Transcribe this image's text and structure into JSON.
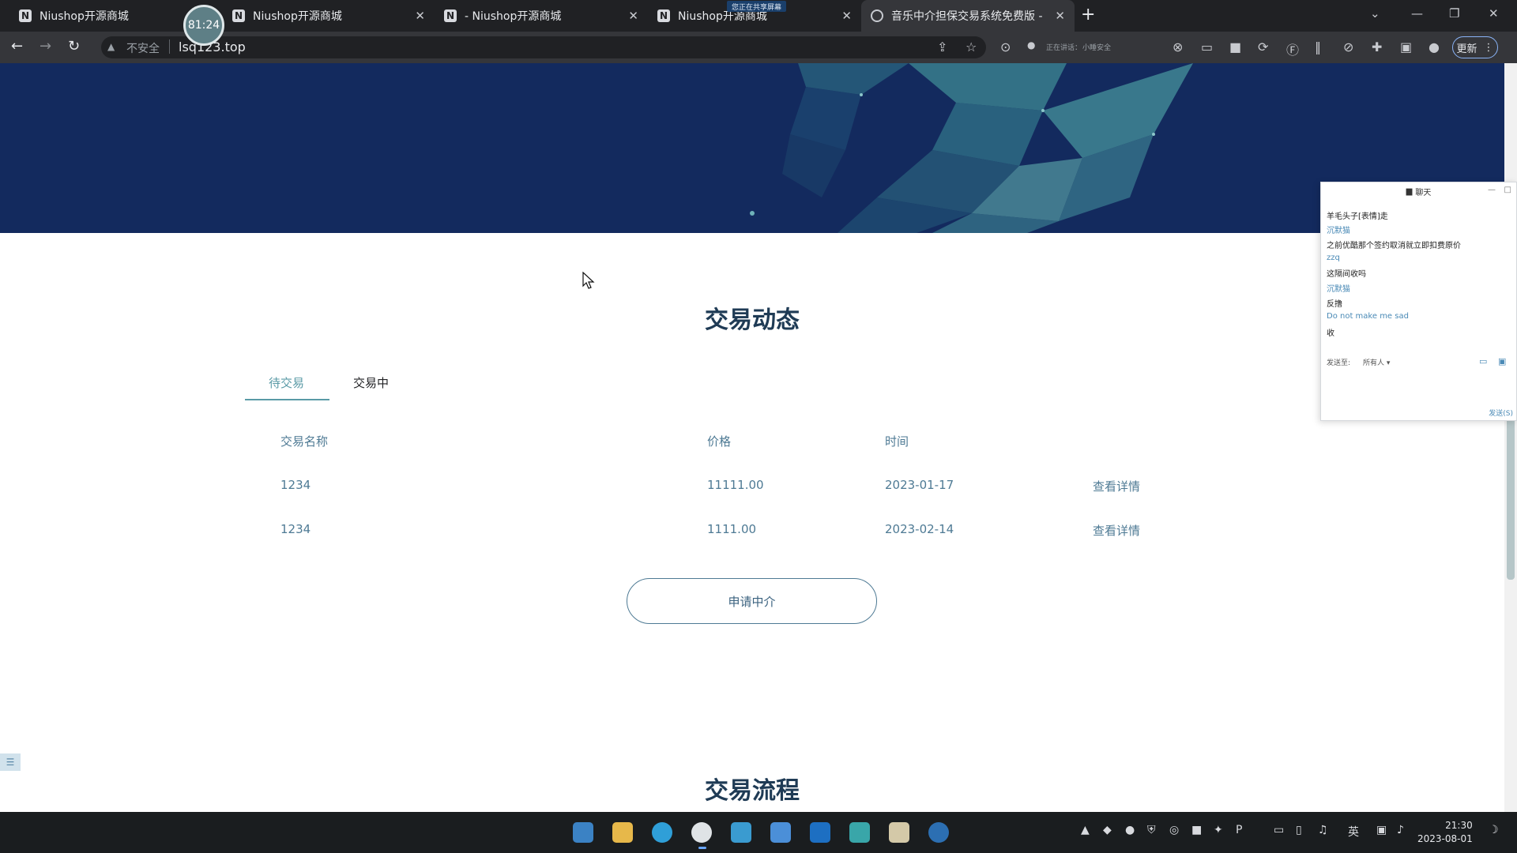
{
  "browser": {
    "tabs": [
      {
        "title": "Niushop开源商城",
        "favicon": "N"
      },
      {
        "title": "Niushop开源商城",
        "favicon": "N"
      },
      {
        "title": "- Niushop开源商城",
        "favicon": "N"
      },
      {
        "title": "Niushop开源商城",
        "favicon": "N"
      },
      {
        "title": "音乐中介担保交易系统免费版 -",
        "favicon": "globe-icon"
      }
    ],
    "timer": "81:24",
    "sharing_badge": "您正在共享屏幕",
    "address": {
      "security_label": "不安全",
      "url": "lsq123.top"
    },
    "toolbar_note_1": "正在讲话：",
    "toolbar_note_2": "小睡安全",
    "update_label": "更新"
  },
  "page": {
    "section_title": "交易动态",
    "tabs": [
      {
        "label": "待交易",
        "active": true
      },
      {
        "label": "交易中",
        "active": false
      }
    ],
    "table": {
      "headers": [
        "交易名称",
        "价格",
        "时间"
      ],
      "rows": [
        {
          "name": "1234",
          "price": "11111.00",
          "date": "2023-01-17",
          "action": "查看详情"
        },
        {
          "name": "1234",
          "price": "1111.00",
          "date": "2023-02-14",
          "action": "查看详情"
        }
      ]
    },
    "apply_button": "申请中介",
    "next_section_title": "交易流程"
  },
  "chat": {
    "title": "聊天",
    "messages": [
      {
        "text": "羊毛头子[表情]走",
        "kind": "body"
      },
      {
        "text": "沉默猫",
        "kind": "name"
      },
      {
        "text": "之前优酷那个签约取消就立即扣费原价",
        "kind": "body"
      },
      {
        "text": "zzq",
        "kind": "name"
      },
      {
        "text": "这隔间收吗",
        "kind": "body"
      },
      {
        "text": "沉默猫",
        "kind": "name"
      },
      {
        "text": "反撸",
        "kind": "body"
      },
      {
        "text": "Do not make me sad",
        "kind": "name"
      },
      {
        "text": "收",
        "kind": "body"
      }
    ],
    "send_to_label": "发送至:",
    "send_to_value": "所有人",
    "send_button": "发送(S)"
  },
  "taskbar": {
    "time": "21:30",
    "date": "2023-08-01",
    "ime": "英"
  },
  "colors": {
    "banner": "#132a5e",
    "accent": "#5a9aa6",
    "table_text": "#4e7a94",
    "title": "#1f3b55"
  }
}
